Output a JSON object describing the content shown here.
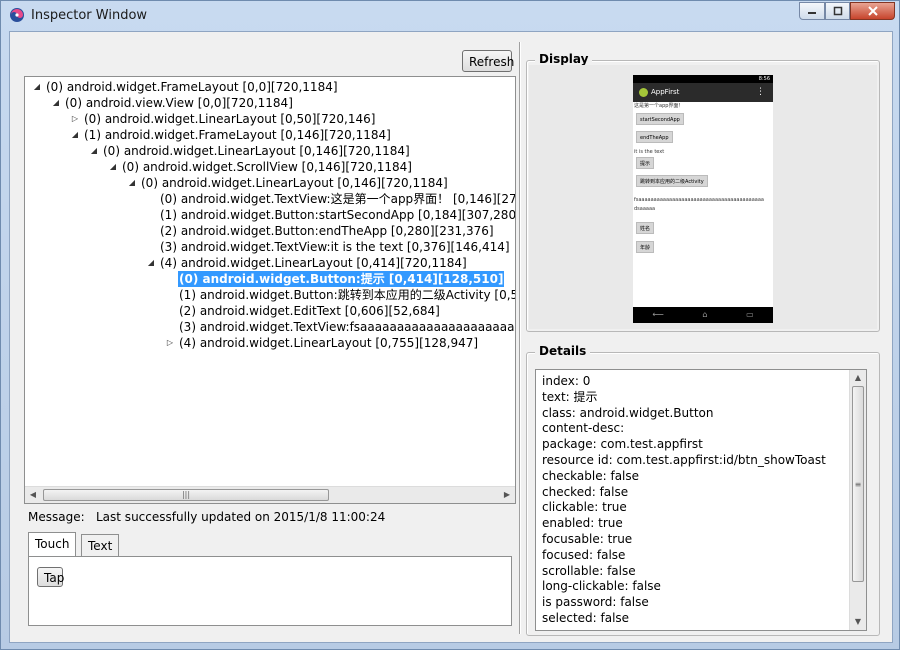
{
  "window": {
    "title": "Inspector Window",
    "icon": "app-swirl-icon",
    "controls": [
      "minimize-icon",
      "maximize-icon",
      "close-icon"
    ]
  },
  "toolbar": {
    "refresh_label": "Refresh"
  },
  "tree": {
    "rows": [
      {
        "depth": 0,
        "arrow": "expanded",
        "label": "(0) android.widget.FrameLayout [0,0][720,1184]"
      },
      {
        "depth": 1,
        "arrow": "expanded",
        "label": "(0) android.view.View [0,0][720,1184]"
      },
      {
        "depth": 2,
        "arrow": "collapsed",
        "label": "(0) android.widget.LinearLayout [0,50][720,146]"
      },
      {
        "depth": 2,
        "arrow": "expanded",
        "label": "(1) android.widget.FrameLayout [0,146][720,1184]"
      },
      {
        "depth": 3,
        "arrow": "expanded",
        "label": "(0) android.widget.LinearLayout [0,146][720,1184]"
      },
      {
        "depth": 4,
        "arrow": "expanded",
        "label": "(0) android.widget.ScrollView [0,146][720,1184]"
      },
      {
        "depth": 5,
        "arrow": "expanded",
        "label": "(0) android.widget.LinearLayout [0,146][720,1184]"
      },
      {
        "depth": 6,
        "arrow": "none",
        "label": "(0) android.widget.TextView:这是第一个app界面！ [0,146][271,1"
      },
      {
        "depth": 6,
        "arrow": "none",
        "label": "(1) android.widget.Button:startSecondApp [0,184][307,280]"
      },
      {
        "depth": 6,
        "arrow": "none",
        "label": "(2) android.widget.Button:endTheApp [0,280][231,376]"
      },
      {
        "depth": 6,
        "arrow": "none",
        "label": "(3) android.widget.TextView:it is the text [0,376][146,414]"
      },
      {
        "depth": 6,
        "arrow": "expanded",
        "label": "(4) android.widget.LinearLayout [0,414][720,1184]"
      },
      {
        "depth": 7,
        "arrow": "none",
        "label": "(0) android.widget.Button:提示 [0,414][128,510]",
        "selected": true
      },
      {
        "depth": 7,
        "arrow": "none",
        "label": "(1) android.widget.Button:跳转到本应用的二级Activity [0,510"
      },
      {
        "depth": 7,
        "arrow": "none",
        "label": "(2) android.widget.EditText [0,606][52,684]"
      },
      {
        "depth": 7,
        "arrow": "none",
        "label": "(3) android.widget.TextView:fsaaaaaaaaaaaaaaaaaaaaaaaaaa"
      },
      {
        "depth": 7,
        "arrow": "collapsed",
        "label": "(4) android.widget.LinearLayout [0,755][128,947]"
      }
    ]
  },
  "message": {
    "label": "Message:",
    "value": "Last successfully updated on 2015/1/8 11:00:24"
  },
  "tabs": [
    {
      "label": "Touch",
      "active": true
    },
    {
      "label": "Text",
      "active": false
    }
  ],
  "touch": {
    "tap_label": "Tap"
  },
  "display": {
    "title": "Display",
    "phone": {
      "status_time": "8:56",
      "app_title": "AppFirst",
      "menu": "⋮",
      "lines": [
        {
          "kind": "text",
          "text": "这是第一个app界面！"
        },
        {
          "kind": "button",
          "text": "startSecondApp"
        },
        {
          "kind": "button",
          "text": "endTheApp"
        },
        {
          "kind": "text",
          "text": "it is the text"
        },
        {
          "kind": "button",
          "text": "提示"
        },
        {
          "kind": "button",
          "text": "跳转到本应用的二级Activity"
        },
        {
          "kind": "text",
          "text": "fsaaaaaaaaaaaaaaaaaaaaaaaaaaaaaaaaaaaaaaaaa"
        },
        {
          "kind": "text",
          "text": "dsaaaaa"
        },
        {
          "kind": "button",
          "text": "姓名"
        },
        {
          "kind": "button",
          "text": "年龄"
        }
      ],
      "nav": [
        "back-icon",
        "home-icon",
        "recents-icon"
      ]
    }
  },
  "details": {
    "title": "Details",
    "lines": [
      "index: 0",
      "text: 提示",
      "class: android.widget.Button",
      "content-desc:",
      "package: com.test.appfirst",
      "resource id: com.test.appfirst:id/btn_showToast",
      "checkable: false",
      "checked: false",
      "clickable: true",
      "enabled: true",
      "focusable: true",
      "focused: false",
      "scrollable: false",
      "long-clickable: false",
      "is password: false",
      "selected: false"
    ]
  }
}
